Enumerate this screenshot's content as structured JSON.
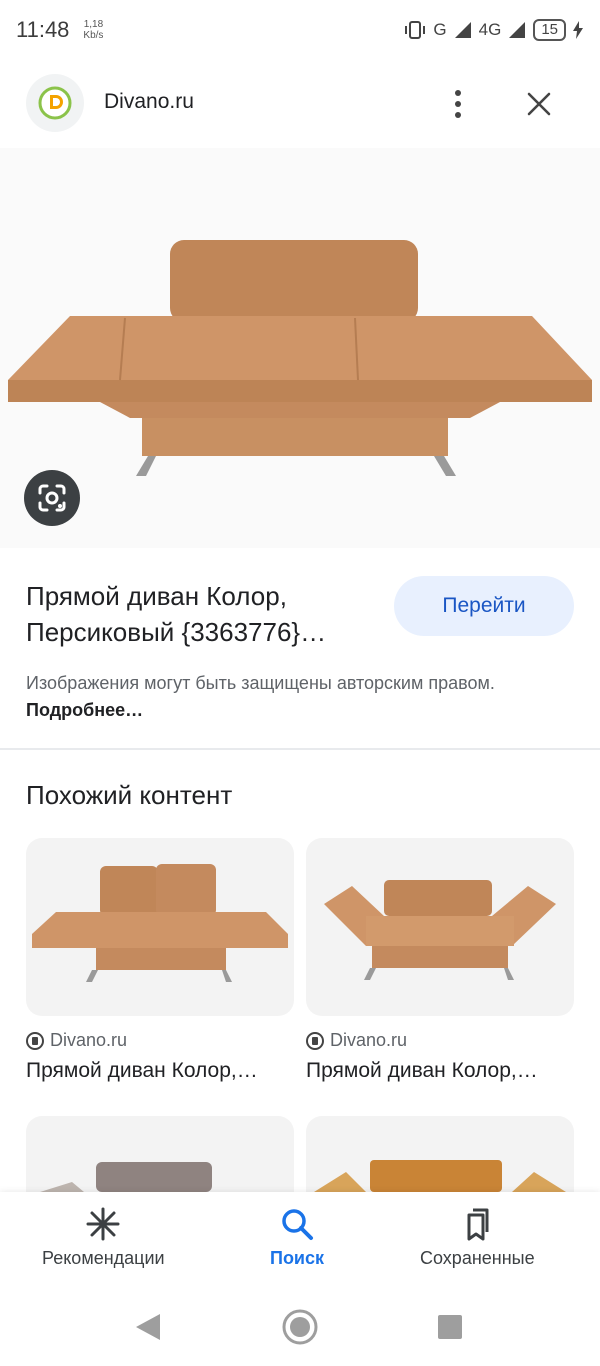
{
  "status": {
    "time": "11:48",
    "netspeed_value": "1,18",
    "netspeed_unit": "Kb/s",
    "network_g": "G",
    "network_4g": "4G",
    "battery": "15"
  },
  "header": {
    "site_name": "Divano.ru"
  },
  "result": {
    "title_line1": "Прямой диван Колор,",
    "title_line2": "Персиковый {3363776}…",
    "goto_label": "Перейти",
    "notice_text": "Изображения могут быть защищены авторским правом.",
    "notice_more": "Подробнее…"
  },
  "similar": {
    "section_title": "Похожий контент",
    "items": [
      {
        "source": "Divano.ru",
        "title": "Прямой диван Колор,…"
      },
      {
        "source": "Divano.ru",
        "title": "Прямой диван Колор,…"
      }
    ]
  },
  "bottom_nav": {
    "items": [
      {
        "label": "Рекомендации",
        "icon": "asterisk-icon"
      },
      {
        "label": "Поиск",
        "icon": "search-icon"
      },
      {
        "label": "Сохраненные",
        "icon": "bookmarks-icon"
      }
    ],
    "active_index": 1
  },
  "colors": {
    "accent": "#1a73e8",
    "button_bg": "#e8f0fe",
    "sofa": "#c98f63"
  }
}
